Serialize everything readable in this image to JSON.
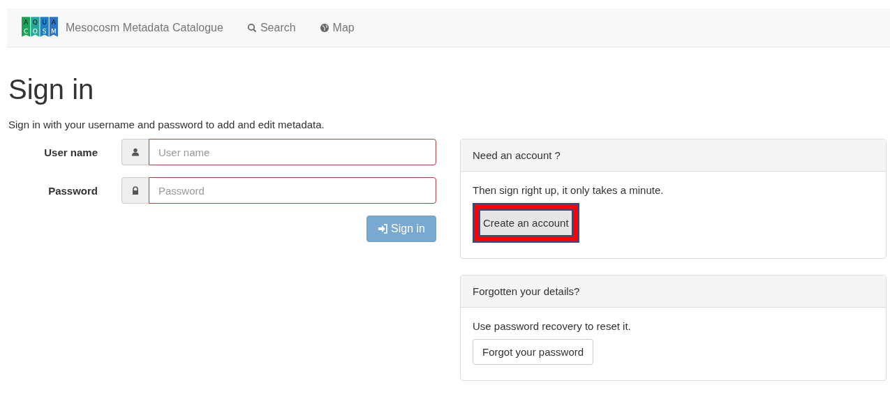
{
  "navbar": {
    "logo_letters": [
      {
        "top": "A",
        "bottom": "C",
        "color": "#1aa35a"
      },
      {
        "top": "Q",
        "bottom": "O",
        "color": "#22a99a"
      },
      {
        "top": "U",
        "bottom": "S",
        "color": "#1f7fc4"
      },
      {
        "top": "A",
        "bottom": "M",
        "color": "#2f73c9"
      }
    ],
    "brand": "Mesocosm Metadata Catalogue",
    "links": [
      {
        "label": "Search"
      },
      {
        "label": "Map"
      }
    ]
  },
  "heading": "Sign in",
  "intro": "Sign in with your username and password to add and edit metadata.",
  "form": {
    "fields": [
      {
        "label": "User name",
        "placeholder": "User name",
        "invalid": true
      },
      {
        "label": "Password",
        "placeholder": "Password",
        "invalid": true
      }
    ],
    "submit": {
      "label": "Sign in",
      "disabled": true
    }
  },
  "panels": [
    {
      "title": "Need an account ?",
      "text": "Then sign right up, it only takes a minute.",
      "button": "Create an account",
      "highlighted": true
    },
    {
      "title": "Forgotten your details?",
      "text": "Use password recovery to reset it.",
      "button": "Forgot your password",
      "highlighted": false
    }
  ]
}
